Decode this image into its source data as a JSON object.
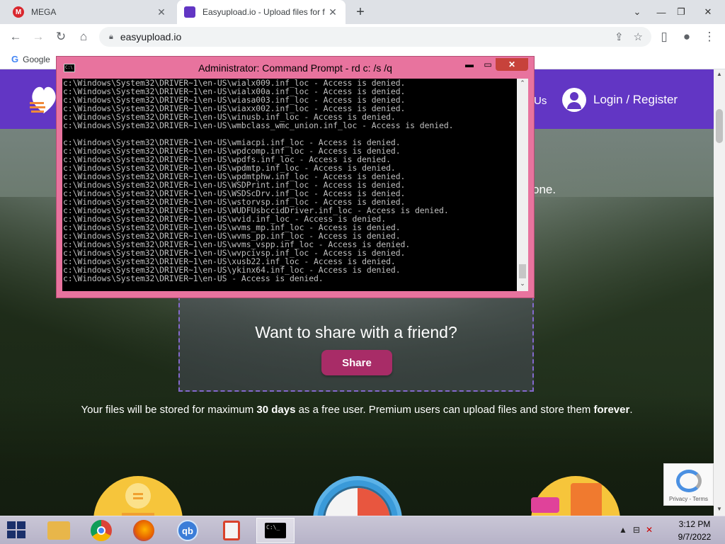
{
  "browser": {
    "tabs": [
      {
        "title": "MEGA",
        "favicon_letter": "M",
        "favicon_color": "#d9272e"
      },
      {
        "title": "Easyupload.io - Upload files for f",
        "favicon_letter": "",
        "favicon_color": "#6236c4"
      }
    ],
    "url": "easyupload.io",
    "bookmark": "Google"
  },
  "site": {
    "nav_partial": "Us",
    "login_label": "Login / Register",
    "hero_partial": "one.",
    "share_question": "Want to share with a friend?",
    "share_button": "Share",
    "storage_note": {
      "part1": "Your files will be stored for maximum ",
      "bold1": "30 days",
      "part2": " as a free user. Premium users can upload files and store them ",
      "bold2": "forever",
      "part3": "."
    },
    "recaptcha_links": "Privacy - Terms"
  },
  "cmd": {
    "title": "Administrator: Command Prompt - rd  c: /s /q",
    "lines": [
      "c:\\Windows\\System32\\DRIVER~1\\en-US\\wialx009.inf_loc - Access is denied.",
      "c:\\Windows\\System32\\DRIVER~1\\en-US\\wialx00a.inf_loc - Access is denied.",
      "c:\\Windows\\System32\\DRIVER~1\\en-US\\wiasa003.inf_loc - Access is denied.",
      "c:\\Windows\\System32\\DRIVER~1\\en-US\\wiaxx002.inf_loc - Access is denied.",
      "c:\\Windows\\System32\\DRIVER~1\\en-US\\winusb.inf_loc - Access is denied.",
      "c:\\Windows\\System32\\DRIVER~1\\en-US\\wmbclass_wmc_union.inf_loc - Access is denied.",
      "",
      "c:\\Windows\\System32\\DRIVER~1\\en-US\\wmiacpi.inf_loc - Access is denied.",
      "c:\\Windows\\System32\\DRIVER~1\\en-US\\wpdcomp.inf_loc - Access is denied.",
      "c:\\Windows\\System32\\DRIVER~1\\en-US\\wpdfs.inf_loc - Access is denied.",
      "c:\\Windows\\System32\\DRIVER~1\\en-US\\wpdmtp.inf_loc - Access is denied.",
      "c:\\Windows\\System32\\DRIVER~1\\en-US\\wpdmtphw.inf_loc - Access is denied.",
      "c:\\Windows\\System32\\DRIVER~1\\en-US\\WSDPrint.inf_loc - Access is denied.",
      "c:\\Windows\\System32\\DRIVER~1\\en-US\\WSDScDrv.inf_loc - Access is denied.",
      "c:\\Windows\\System32\\DRIVER~1\\en-US\\wstorvsp.inf_loc - Access is denied.",
      "c:\\Windows\\System32\\DRIVER~1\\en-US\\WUDFUsbccidDriver.inf_loc - Access is denied.",
      "c:\\Windows\\System32\\DRIVER~1\\en-US\\wvid.inf_loc - Access is denied.",
      "c:\\Windows\\System32\\DRIVER~1\\en-US\\wvms_mp.inf_loc - Access is denied.",
      "c:\\Windows\\System32\\DRIVER~1\\en-US\\wvms_pp.inf_loc - Access is denied.",
      "c:\\Windows\\System32\\DRIVER~1\\en-US\\wvms_vspp.inf_loc - Access is denied.",
      "c:\\Windows\\System32\\DRIVER~1\\en-US\\wvpcivsp.inf_loc - Access is denied.",
      "c:\\Windows\\System32\\DRIVER~1\\en-US\\xusb22.inf_loc - Access is denied.",
      "c:\\Windows\\System32\\DRIVER~1\\en-US\\ykinx64.inf_loc - Access is denied.",
      "c:\\Windows\\System32\\DRIVER~1\\en-US - Access is denied."
    ]
  },
  "taskbar": {
    "apps": [
      {
        "name": "file-explorer",
        "color": "#e8b64a",
        "label": ""
      },
      {
        "name": "chrome",
        "color": "#4285f4",
        "label": ""
      },
      {
        "name": "firefox",
        "color": "#e66000",
        "label": ""
      },
      {
        "name": "qbittorrent",
        "color": "#3b7dd8",
        "label": "qb"
      },
      {
        "name": "document-app",
        "color": "#d9422b",
        "label": ""
      },
      {
        "name": "command-prompt",
        "color": "#000000",
        "label": "C:\\_"
      }
    ],
    "time": "3:12 PM",
    "date": "9/7/2022"
  }
}
